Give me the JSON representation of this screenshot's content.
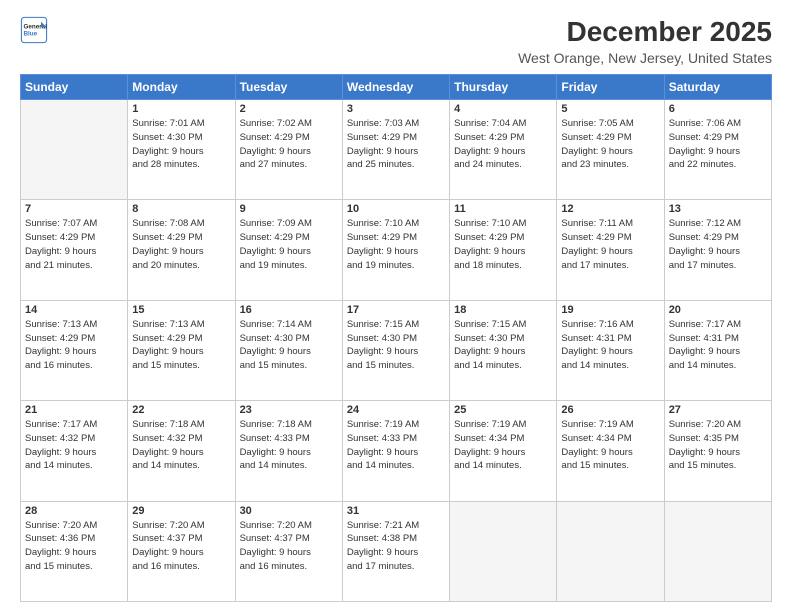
{
  "header": {
    "logo_line1": "General",
    "logo_line2": "Blue",
    "title": "December 2025",
    "subtitle": "West Orange, New Jersey, United States"
  },
  "days_of_week": [
    "Sunday",
    "Monday",
    "Tuesday",
    "Wednesday",
    "Thursday",
    "Friday",
    "Saturday"
  ],
  "weeks": [
    [
      {
        "day": "",
        "info": ""
      },
      {
        "day": "1",
        "info": "Sunrise: 7:01 AM\nSunset: 4:30 PM\nDaylight: 9 hours\nand 28 minutes."
      },
      {
        "day": "2",
        "info": "Sunrise: 7:02 AM\nSunset: 4:29 PM\nDaylight: 9 hours\nand 27 minutes."
      },
      {
        "day": "3",
        "info": "Sunrise: 7:03 AM\nSunset: 4:29 PM\nDaylight: 9 hours\nand 25 minutes."
      },
      {
        "day": "4",
        "info": "Sunrise: 7:04 AM\nSunset: 4:29 PM\nDaylight: 9 hours\nand 24 minutes."
      },
      {
        "day": "5",
        "info": "Sunrise: 7:05 AM\nSunset: 4:29 PM\nDaylight: 9 hours\nand 23 minutes."
      },
      {
        "day": "6",
        "info": "Sunrise: 7:06 AM\nSunset: 4:29 PM\nDaylight: 9 hours\nand 22 minutes."
      }
    ],
    [
      {
        "day": "7",
        "info": "Sunrise: 7:07 AM\nSunset: 4:29 PM\nDaylight: 9 hours\nand 21 minutes."
      },
      {
        "day": "8",
        "info": "Sunrise: 7:08 AM\nSunset: 4:29 PM\nDaylight: 9 hours\nand 20 minutes."
      },
      {
        "day": "9",
        "info": "Sunrise: 7:09 AM\nSunset: 4:29 PM\nDaylight: 9 hours\nand 19 minutes."
      },
      {
        "day": "10",
        "info": "Sunrise: 7:10 AM\nSunset: 4:29 PM\nDaylight: 9 hours\nand 19 minutes."
      },
      {
        "day": "11",
        "info": "Sunrise: 7:10 AM\nSunset: 4:29 PM\nDaylight: 9 hours\nand 18 minutes."
      },
      {
        "day": "12",
        "info": "Sunrise: 7:11 AM\nSunset: 4:29 PM\nDaylight: 9 hours\nand 17 minutes."
      },
      {
        "day": "13",
        "info": "Sunrise: 7:12 AM\nSunset: 4:29 PM\nDaylight: 9 hours\nand 17 minutes."
      }
    ],
    [
      {
        "day": "14",
        "info": "Sunrise: 7:13 AM\nSunset: 4:29 PM\nDaylight: 9 hours\nand 16 minutes."
      },
      {
        "day": "15",
        "info": "Sunrise: 7:13 AM\nSunset: 4:29 PM\nDaylight: 9 hours\nand 15 minutes."
      },
      {
        "day": "16",
        "info": "Sunrise: 7:14 AM\nSunset: 4:30 PM\nDaylight: 9 hours\nand 15 minutes."
      },
      {
        "day": "17",
        "info": "Sunrise: 7:15 AM\nSunset: 4:30 PM\nDaylight: 9 hours\nand 15 minutes."
      },
      {
        "day": "18",
        "info": "Sunrise: 7:15 AM\nSunset: 4:30 PM\nDaylight: 9 hours\nand 14 minutes."
      },
      {
        "day": "19",
        "info": "Sunrise: 7:16 AM\nSunset: 4:31 PM\nDaylight: 9 hours\nand 14 minutes."
      },
      {
        "day": "20",
        "info": "Sunrise: 7:17 AM\nSunset: 4:31 PM\nDaylight: 9 hours\nand 14 minutes."
      }
    ],
    [
      {
        "day": "21",
        "info": "Sunrise: 7:17 AM\nSunset: 4:32 PM\nDaylight: 9 hours\nand 14 minutes."
      },
      {
        "day": "22",
        "info": "Sunrise: 7:18 AM\nSunset: 4:32 PM\nDaylight: 9 hours\nand 14 minutes."
      },
      {
        "day": "23",
        "info": "Sunrise: 7:18 AM\nSunset: 4:33 PM\nDaylight: 9 hours\nand 14 minutes."
      },
      {
        "day": "24",
        "info": "Sunrise: 7:19 AM\nSunset: 4:33 PM\nDaylight: 9 hours\nand 14 minutes."
      },
      {
        "day": "25",
        "info": "Sunrise: 7:19 AM\nSunset: 4:34 PM\nDaylight: 9 hours\nand 14 minutes."
      },
      {
        "day": "26",
        "info": "Sunrise: 7:19 AM\nSunset: 4:34 PM\nDaylight: 9 hours\nand 15 minutes."
      },
      {
        "day": "27",
        "info": "Sunrise: 7:20 AM\nSunset: 4:35 PM\nDaylight: 9 hours\nand 15 minutes."
      }
    ],
    [
      {
        "day": "28",
        "info": "Sunrise: 7:20 AM\nSunset: 4:36 PM\nDaylight: 9 hours\nand 15 minutes."
      },
      {
        "day": "29",
        "info": "Sunrise: 7:20 AM\nSunset: 4:37 PM\nDaylight: 9 hours\nand 16 minutes."
      },
      {
        "day": "30",
        "info": "Sunrise: 7:20 AM\nSunset: 4:37 PM\nDaylight: 9 hours\nand 16 minutes."
      },
      {
        "day": "31",
        "info": "Sunrise: 7:21 AM\nSunset: 4:38 PM\nDaylight: 9 hours\nand 17 minutes."
      },
      {
        "day": "",
        "info": ""
      },
      {
        "day": "",
        "info": ""
      },
      {
        "day": "",
        "info": ""
      }
    ]
  ]
}
